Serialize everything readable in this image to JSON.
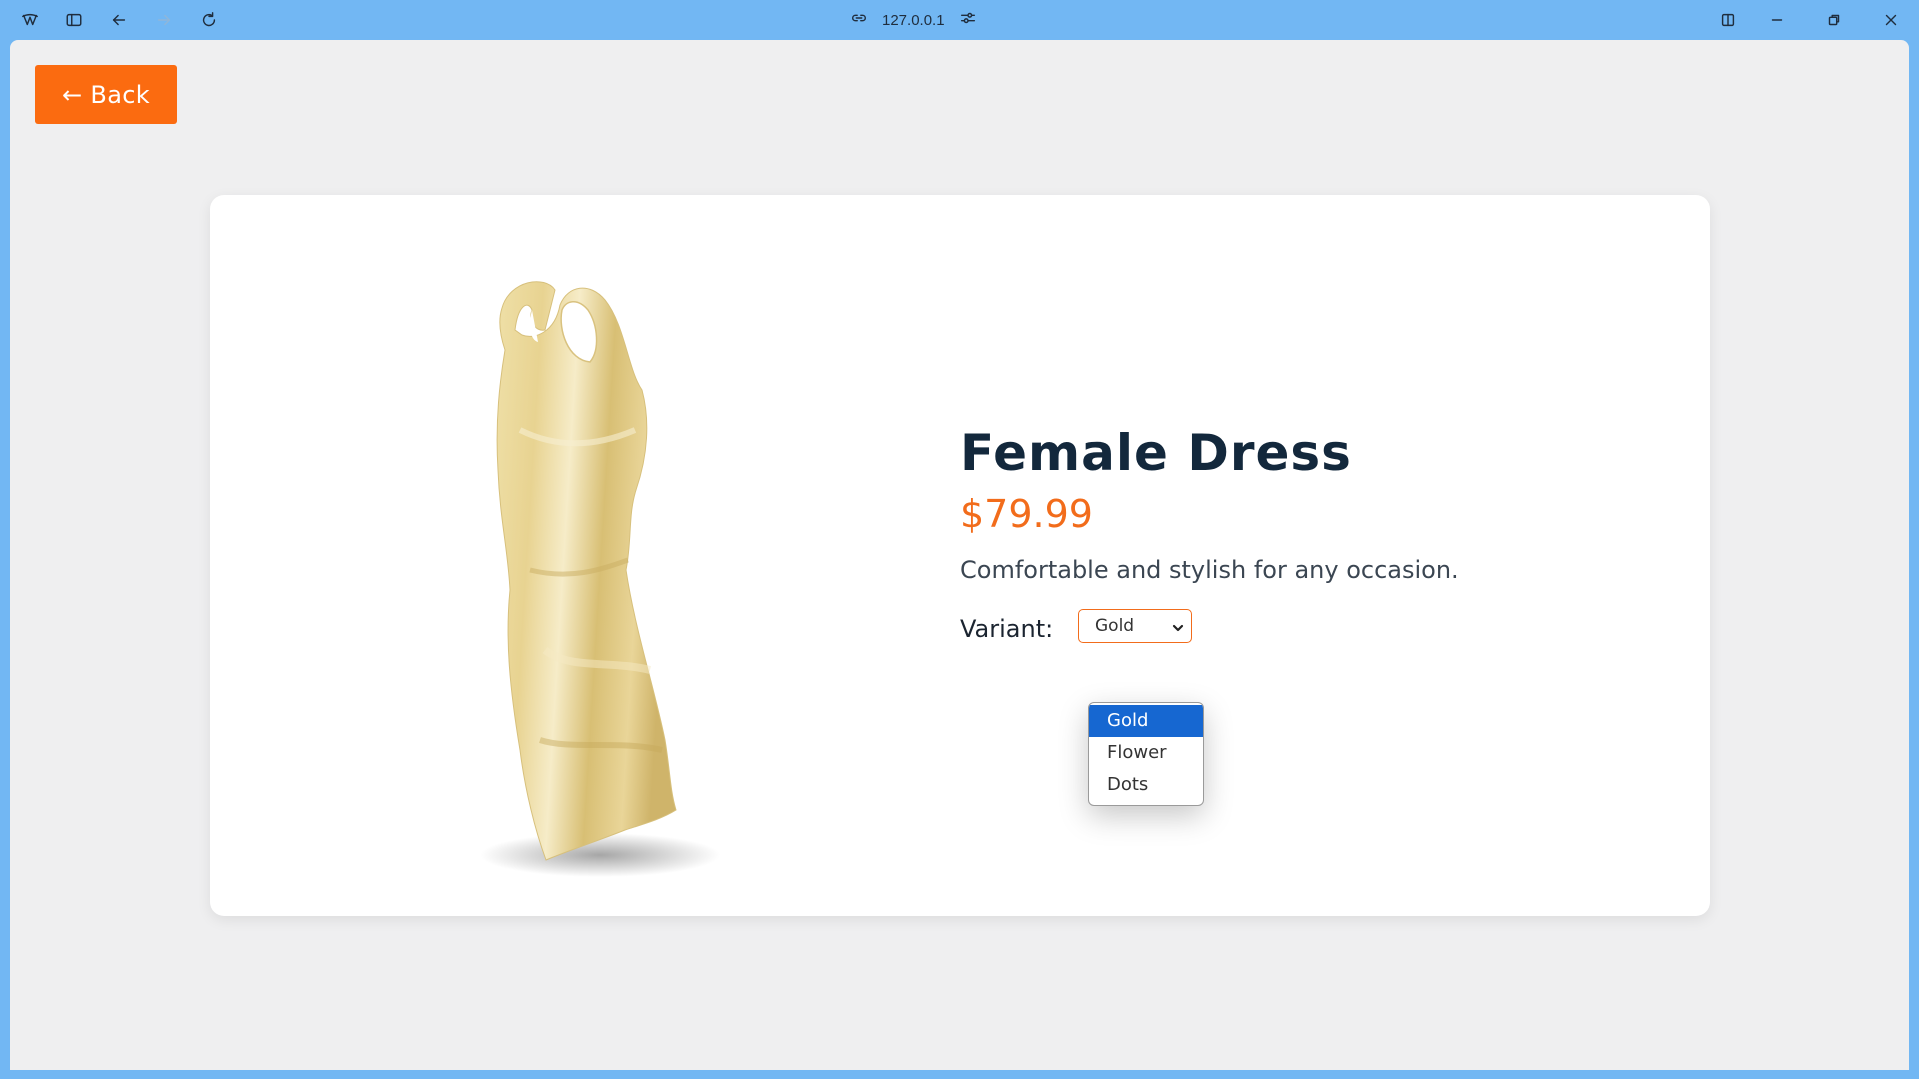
{
  "browser": {
    "url": "127.0.0.1",
    "icons": [
      "app-logo-icon",
      "sidebar-toggle-icon",
      "back-arrow-icon",
      "forward-arrow-icon",
      "reload-icon",
      "link-icon",
      "site-settings-icon",
      "split-view-icon",
      "minimize-icon",
      "restore-icon",
      "close-icon"
    ]
  },
  "page": {
    "back_label": "← Back",
    "product": {
      "title": "Female Dress",
      "price": "$79.99",
      "description": "Comfortable and stylish for any occasion.",
      "variant_label": "Variant:",
      "selected_variant": "Gold",
      "options": [
        "Gold",
        "Flower",
        "Dots"
      ]
    }
  },
  "colors": {
    "accent": "#fb6b10",
    "title": "#13283c",
    "page_bg": "#efeff0",
    "chrome_bg": "#72b7f3",
    "option_highlight": "#1667d1"
  }
}
